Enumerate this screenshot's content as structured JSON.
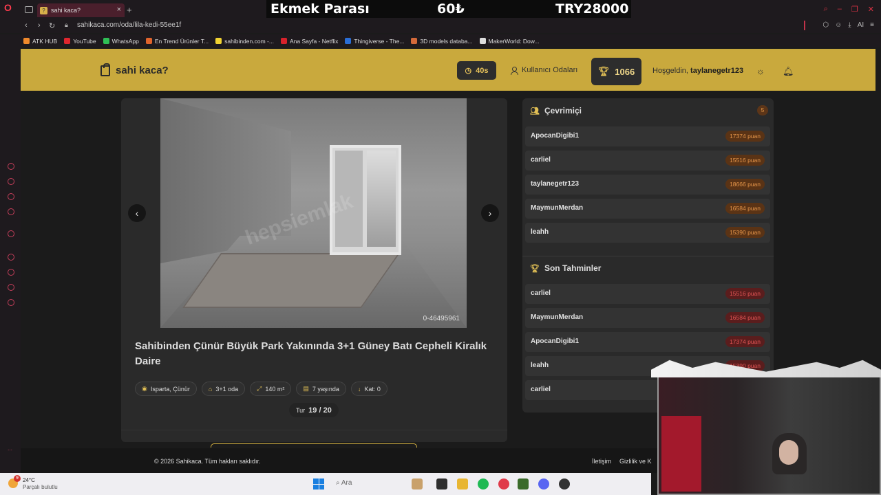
{
  "browser": {
    "tab_title": "sahi kaca?",
    "tab_favicon": "?",
    "url": "sahikaca.com/oda/lila-kedi-55ee1f",
    "bookmarks": [
      {
        "label": "ATK HUB",
        "color": "#f08a2c"
      },
      {
        "label": "YouTube",
        "color": "#e0262e"
      },
      {
        "label": "WhatsApp",
        "color": "#2fbf55"
      },
      {
        "label": "En Trend Ürünler T...",
        "color": "#e0642c"
      },
      {
        "label": "sahibinden.com -...",
        "color": "#f1d332"
      },
      {
        "label": "Ana Sayfa - Netflix",
        "color": "#d8222b"
      },
      {
        "label": "Thingiverse - The...",
        "color": "#2a6ed6"
      },
      {
        "label": "3D models databa...",
        "color": "#d46a3a"
      },
      {
        "label": "MakerWorld: Dow...",
        "color": "#dddddd"
      }
    ]
  },
  "stream_banner": {
    "label": "Ekmek Parası",
    "amount": "60₺",
    "total": "TRY28000"
  },
  "site": {
    "logo": "sahi kaca?",
    "timer": "40s",
    "rooms_link": "Kullanıcı Odaları",
    "score": "1066",
    "welcome_prefix": "Hoşgeldin,",
    "username": "taylanegetr123",
    "accent_color": "#c9a93d"
  },
  "listing": {
    "photo_code": "0-46495961",
    "watermark": "hepsiemlak",
    "title": "Sahibinden Çünür Büyük Park Yakınında 3+1 Güney Batı Cepheli Kiralık Daire",
    "location": "Isparta, Çünür",
    "rooms": "3+1 oda",
    "area": "140 m²",
    "age": "7 yaşında",
    "floor": "Kat: 0",
    "round_label": "Tur",
    "round_value": "19 / 20"
  },
  "online": {
    "title": "Çevrimiçi",
    "count": "5",
    "players": [
      {
        "name": "ApocanDigibi1",
        "score": "17374 puan"
      },
      {
        "name": "carliel",
        "score": "15516 puan"
      },
      {
        "name": "taylanegetr123",
        "score": "18666 puan"
      },
      {
        "name": "MaymunMerdan",
        "score": "16584 puan"
      },
      {
        "name": "leahh",
        "score": "15390 puan"
      }
    ]
  },
  "recent": {
    "title": "Son Tahminler",
    "guesses": [
      {
        "name": "carliel",
        "score": "15516 puan"
      },
      {
        "name": "MaymunMerdan",
        "score": "16584 puan"
      },
      {
        "name": "ApocanDigibi1",
        "score": "17374 puan"
      },
      {
        "name": "leahh",
        "score": "15390 puan"
      },
      {
        "name": "carliel",
        "score": ""
      }
    ]
  },
  "footer": {
    "copyright": "© 2026 Sahikaca. Tüm hakları saklıdır.",
    "contact": "İletişim",
    "privacy": "Gizlilik ve K"
  },
  "taskbar": {
    "weather_badge": "9",
    "temperature": "24°C",
    "weather_desc": "Parçalı bulutlu",
    "search_placeholder": "Ara"
  }
}
